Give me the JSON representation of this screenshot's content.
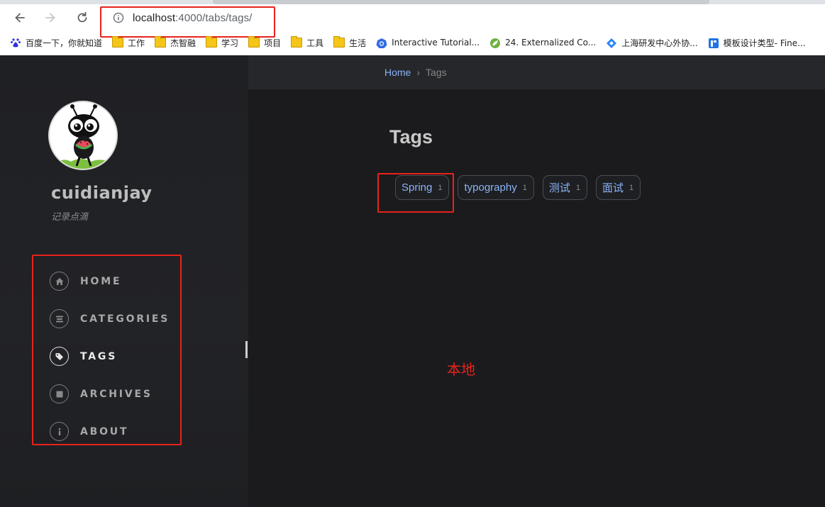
{
  "browser": {
    "url_host": "localhost",
    "url_rest": ":4000/tabs/tags/",
    "bookmarks": [
      {
        "label": "百度一下，你就知道",
        "icon": "baidu-icon"
      },
      {
        "label": "工作",
        "icon": "folder-icon"
      },
      {
        "label": "杰智融",
        "icon": "folder-icon"
      },
      {
        "label": "学习",
        "icon": "folder-icon"
      },
      {
        "label": "项目",
        "icon": "folder-icon"
      },
      {
        "label": "工具",
        "icon": "folder-icon"
      },
      {
        "label": "生活",
        "icon": "folder-icon"
      },
      {
        "label": "Interactive Tutorial...",
        "icon": "kubernetes-icon"
      },
      {
        "label": "24. Externalized Co...",
        "icon": "spring-icon"
      },
      {
        "label": "上海研发中心外协...",
        "icon": "jira-icon"
      },
      {
        "label": "模板设计类型- Fine...",
        "icon": "fine-icon"
      }
    ]
  },
  "sidebar": {
    "title": "cuidianjay",
    "subtitle": "记录点滴",
    "nav": [
      {
        "label": "HOME",
        "icon": "home-icon"
      },
      {
        "label": "CATEGORIES",
        "icon": "stream-icon"
      },
      {
        "label": "TAGS",
        "icon": "tags-icon",
        "active": true
      },
      {
        "label": "ARCHIVES",
        "icon": "archive-icon"
      },
      {
        "label": "ABOUT",
        "icon": "info-icon"
      }
    ]
  },
  "topbar": {
    "breadcrumb_home": "Home",
    "breadcrumb_sep": "›",
    "breadcrumb_current": "Tags"
  },
  "main": {
    "title": "Tags",
    "tags": [
      {
        "name": "Spring",
        "count": "1"
      },
      {
        "name": "typography",
        "count": "1"
      },
      {
        "name": "测试",
        "count": "1"
      },
      {
        "name": "面试",
        "count": "1"
      }
    ]
  },
  "annotation": "本地",
  "colors": {
    "highlight_red": "#e8231b",
    "link_blue": "#8ab4f8",
    "background": "#1b1b1e"
  }
}
